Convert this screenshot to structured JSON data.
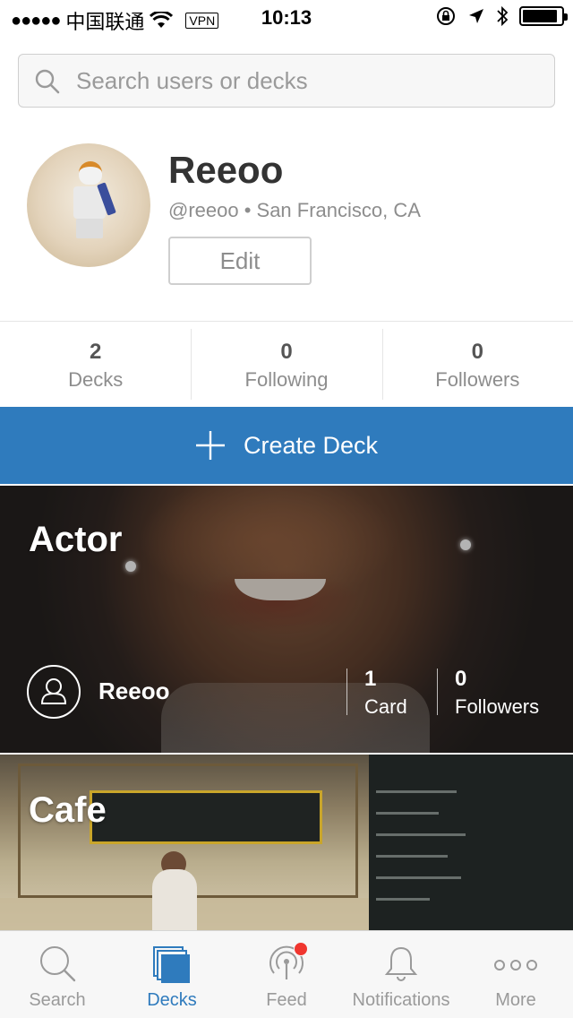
{
  "status_bar": {
    "signal": "●●●●●",
    "carrier": "中国联通",
    "vpn": "VPN",
    "time": "10:13"
  },
  "search": {
    "placeholder": "Search users or decks",
    "icon": "search-icon"
  },
  "profile": {
    "name": "Reeoo",
    "meta": "@reeoo • San Francisco, CA",
    "edit_label": "Edit"
  },
  "stats": [
    {
      "value": "2",
      "label": "Decks"
    },
    {
      "value": "0",
      "label": "Following"
    },
    {
      "value": "0",
      "label": "Followers"
    }
  ],
  "create_deck": {
    "label": "Create Deck",
    "icon": "plus-icon"
  },
  "decks": [
    {
      "title": "Actor",
      "owner": "Reeoo",
      "cards_value": "1",
      "cards_label": "Card",
      "followers_value": "0",
      "followers_label": "Followers"
    },
    {
      "title": "Cafe"
    }
  ],
  "tabs": [
    {
      "label": "Search",
      "icon": "search-icon",
      "active": false
    },
    {
      "label": "Decks",
      "icon": "decks-icon",
      "active": true
    },
    {
      "label": "Feed",
      "icon": "feed-icon",
      "active": false,
      "badge": true
    },
    {
      "label": "Notifications",
      "icon": "bell-icon",
      "active": false
    },
    {
      "label": "More",
      "icon": "more-icon",
      "active": false
    }
  ],
  "colors": {
    "accent": "#2f7bbd",
    "badge": "#f0362f",
    "muted_text": "#8d8d8d"
  }
}
